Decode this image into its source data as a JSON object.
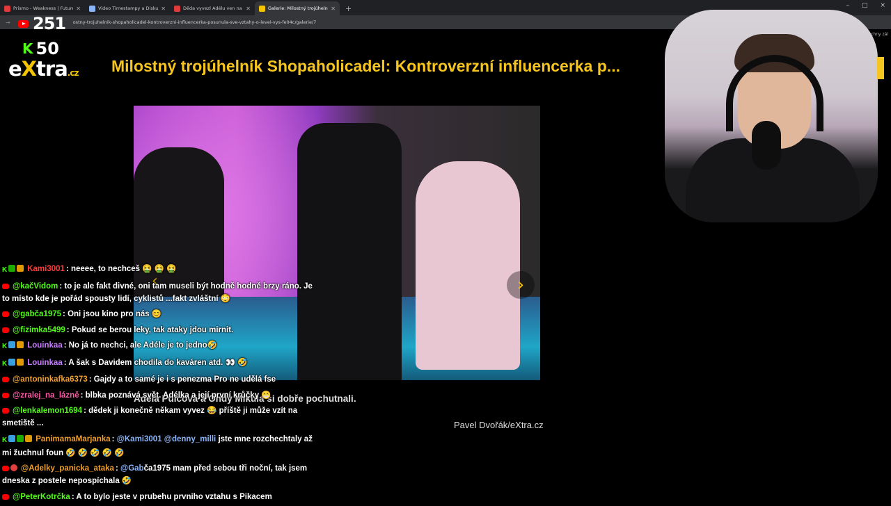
{
  "browser": {
    "tabs": [
      {
        "title": "Prismo - Weakness | Future Ba",
        "favicon_color": "#e03a3a",
        "active": false
      },
      {
        "title": "Video Timestampy a Diskuze -",
        "favicon_color": "#8ab4f8",
        "active": false
      },
      {
        "title": "Děda vyvezl Adélu ven na výlet",
        "favicon_color": "#e03a3a",
        "active": false
      },
      {
        "title": "Galerie: Milostný trojúhelník Ad",
        "favicon_color": "#f4c400",
        "active": true
      }
    ],
    "new_tab": "+",
    "window_controls": [
      "–",
      "□",
      "×"
    ],
    "url": "ostny-trojuhelnik-shopaholicadel-kontroverzni-influencerka-posunula-sve-vztahy-o-level-vys-fe04c/galerie/7",
    "bookmark_label": "Všechny zál"
  },
  "overlay": {
    "youtube_count": "251",
    "kick_count": "50"
  },
  "site": {
    "logo_e": "e",
    "logo_x": "X",
    "logo_tra": "tra",
    "logo_cz": ".cz",
    "title": "Milostný trojúhelník Shopaholicadel: Kontroverzní influencerka p...",
    "caption": "Adéla Pulcová a Ondy Mikula si dobře pochutnali.",
    "credit": "Pavel Dvořák/eXtra.cz",
    "next_arrow": "›",
    "prev_arrow": "‹"
  },
  "chat": [
    {
      "platform": "kick",
      "badges": [
        "g",
        "o"
      ],
      "user": "Kami3001",
      "color": "#ff3b3b",
      "text": ": neeee, to nechceš 🤮 🤮 🤮"
    },
    {
      "platform": "youtube",
      "badges": [],
      "user": "@kačVidom",
      "color": "#53fc18",
      "text": ": to je ale fakt divné, oni tam museli být hodně hodně brzy ráno. Je to místo kde je pořád spousty lidí, cyklistů ...fakt zvláštní 😳"
    },
    {
      "platform": "youtube",
      "badges": [],
      "user": "@gabča1975",
      "color": "#53fc18",
      "text": ": Oni jsou kino pro nás 😊"
    },
    {
      "platform": "youtube",
      "badges": [],
      "user": "@fizimka5499",
      "color": "#53fc18",
      "text": ": Pokud se berou leky, tak ataky jdou mirnit."
    },
    {
      "platform": "kick",
      "badges": [
        "c",
        "o"
      ],
      "user": "Louinkaa",
      "color": "#c77dff",
      "text": ": No já to nechci, ale Adéle je to jedno🤣"
    },
    {
      "platform": "kick",
      "badges": [
        "c",
        "o"
      ],
      "user": "Louinkaa",
      "color": "#c77dff",
      "text": ": A šak s Davidem chodila do kaváren atd. 👀 🤣"
    },
    {
      "platform": "youtube",
      "badges": [],
      "user": "@antoninkafka6373",
      "color": "#f0a030",
      "text": ": Gajdy a to samé je i s penezma Pro ne udělá fse"
    },
    {
      "platform": "youtube",
      "badges": [],
      "user": "@zralej_na_lázně",
      "color": "#ff5aa5",
      "text": ": blbka poznává svět. Adélka a její první krůčky 😁"
    },
    {
      "platform": "youtube",
      "badges": [],
      "user": "@lenkalemon1694",
      "color": "#53fc18",
      "text": ": dědek ji konečně někam vyvez 😂 příště ji může vzít na smetiště ..."
    },
    {
      "platform": "kick",
      "badges": [
        "c",
        "g",
        "o"
      ],
      "user": "PanimamaMarjanka",
      "color": "#f0a030",
      "text": ": ",
      "mentions": "@Kami3001 @denny_milli",
      "text2": " jste mne rozchechtaly až mi žuchnul foun 🤣 🤣 🤣 🤣 🤣"
    },
    {
      "platform": "youtube",
      "badges": [
        "r"
      ],
      "user": "@Adelky_panicka_ataka",
      "color": "#f0a030",
      "text": ": ",
      "mentions": "@Gab",
      "text2": "ča1975 mam před sebou tři noční, tak jsem dneska z postele nepospíchala 🤣"
    },
    {
      "platform": "youtube",
      "badges": [],
      "user": "@PeterKotrčka",
      "color": "#53fc18",
      "text": ": A to bylo jeste v prubehu prvniho vztahu s Pikacem"
    }
  ]
}
